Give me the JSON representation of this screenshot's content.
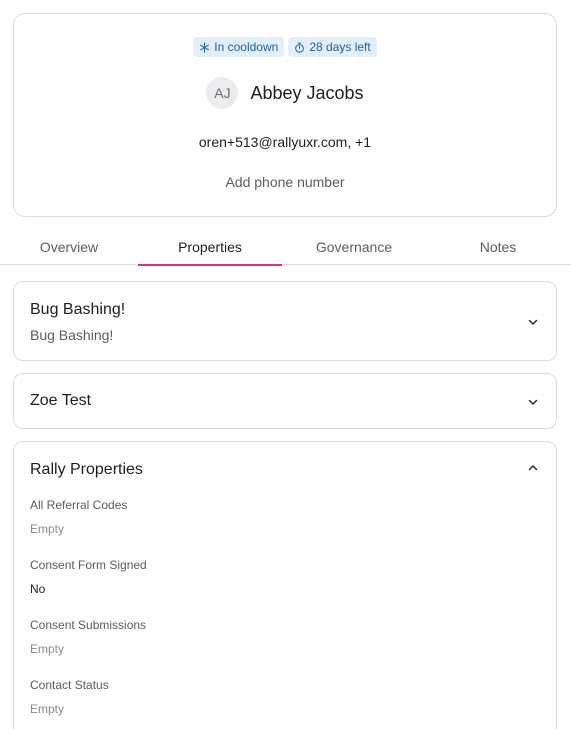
{
  "profile": {
    "badges": [
      {
        "label": "In cooldown",
        "icon": "snowflake-icon"
      },
      {
        "label": "28 days left",
        "icon": "stopwatch-icon"
      }
    ],
    "initials": "AJ",
    "name": "Abbey Jacobs",
    "email": "oren+513@rallyuxr.com, +1",
    "add_phone": "Add phone number",
    "badge_bg": "#e3f0fb",
    "badge_color": "#1b63a8"
  },
  "tabs": [
    {
      "label": "Overview",
      "active": false
    },
    {
      "label": "Properties",
      "active": true
    },
    {
      "label": "Governance",
      "active": false
    },
    {
      "label": "Notes",
      "active": false
    }
  ],
  "accent_color": "#d6338f",
  "sections": [
    {
      "title": "Bug Bashing!",
      "subtitle": "Bug Bashing!",
      "expanded": false
    },
    {
      "title": "Zoe Test",
      "expanded": false
    },
    {
      "title": "Rally Properties",
      "expanded": true,
      "properties": [
        {
          "label": "All Referral Codes",
          "value": "Empty"
        },
        {
          "label": "Consent Form Signed",
          "value": "No"
        },
        {
          "label": "Consent Submissions",
          "value": "Empty"
        },
        {
          "label": "Contact Status",
          "value": "Empty"
        }
      ]
    }
  ]
}
